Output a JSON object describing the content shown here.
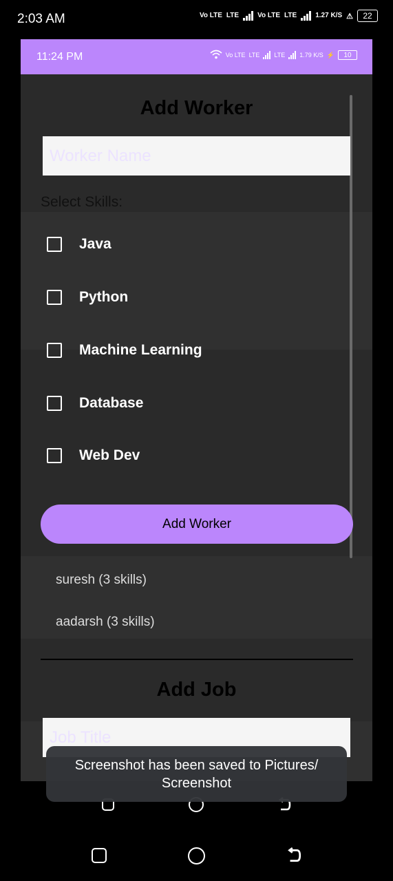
{
  "outer_status": {
    "time": "2:03 AM",
    "net1": "Vo LTE",
    "net1_tag": "LTE",
    "net2": "Vo LTE",
    "net2_tag": "LTE",
    "speed": "1.27 K/S",
    "battery": "22"
  },
  "inner_status": {
    "time": "11:24 PM",
    "net": "Vo LTE",
    "tag1": "LTE",
    "tag2": "LTE",
    "speed": "1.79 K/S",
    "battery": "10"
  },
  "worker_form": {
    "title": "Add Worker",
    "name_placeholder": "Worker Name",
    "skills_label": "Select Skills:",
    "skills": [
      {
        "label": "Java",
        "checked": false
      },
      {
        "label": "Python",
        "checked": false
      },
      {
        "label": "Machine Learning",
        "checked": false
      },
      {
        "label": "Database",
        "checked": false
      },
      {
        "label": "Web Dev",
        "checked": false
      }
    ],
    "submit_label": "Add Worker"
  },
  "workers": [
    "suresh (3 skills)",
    "aadarsh (3 skills)"
  ],
  "job_form": {
    "title": "Add Job",
    "title_placeholder": "Job Title"
  },
  "toast": {
    "message": "Screenshot has been saved to  Pictures/ Screenshot"
  },
  "colors": {
    "accent": "#bb86fc",
    "background": "#2a2a2a",
    "band": "#303030"
  }
}
